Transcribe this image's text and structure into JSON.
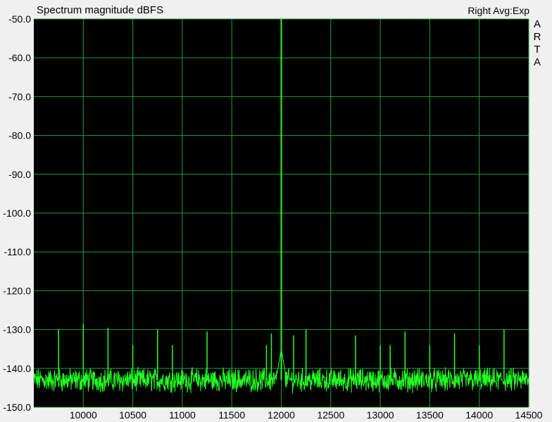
{
  "chart_data": {
    "type": "line",
    "title": "Spectrum magnitude dBFS",
    "status_label": "Right Avg:Exp",
    "brand_letters": [
      "A",
      "R",
      "T",
      "A"
    ],
    "xlim": [
      9500,
      14500
    ],
    "ylim": [
      -150,
      -50
    ],
    "x_ticks": [
      10000,
      10500,
      11000,
      11500,
      12000,
      12500,
      13000,
      13500,
      14000,
      14500
    ],
    "y_ticks": [
      "-50.0",
      "-60.0",
      "-70.0",
      "-80.0",
      "-90.0",
      "-100.0",
      "-110.0",
      "-120.0",
      "-130.0",
      "-140.0",
      "-150.0"
    ],
    "y_tick_values": [
      -50,
      -60,
      -70,
      -80,
      -90,
      -100,
      -110,
      -120,
      -130,
      -140,
      -150
    ],
    "grid": true,
    "colors": {
      "plot_bg": "#000000",
      "grid": "#1f9e3a",
      "trace": "#22ff22",
      "frame": "#f0f0f0"
    },
    "series": [
      {
        "noise_floor_db": -143,
        "peaks": [
          {
            "x": 9750,
            "y": -130
          },
          {
            "x": 10000,
            "y": -128.5
          },
          {
            "x": 10250,
            "y": -129.5
          },
          {
            "x": 10500,
            "y": -134
          },
          {
            "x": 10750,
            "y": -130
          },
          {
            "x": 10900,
            "y": -134
          },
          {
            "x": 11250,
            "y": -130.5
          },
          {
            "x": 11850,
            "y": -134
          },
          {
            "x": 11900,
            "y": -131
          },
          {
            "x": 12000,
            "y": -50
          },
          {
            "x": 12125,
            "y": -131.5
          },
          {
            "x": 12250,
            "y": -130
          },
          {
            "x": 12750,
            "y": -131.5
          },
          {
            "x": 13000,
            "y": -134
          },
          {
            "x": 13100,
            "y": -134
          },
          {
            "x": 13250,
            "y": -130.5
          },
          {
            "x": 13500,
            "y": -134
          },
          {
            "x": 13750,
            "y": -131
          },
          {
            "x": 14000,
            "y": -134
          },
          {
            "x": 14250,
            "y": -130
          }
        ]
      }
    ]
  }
}
